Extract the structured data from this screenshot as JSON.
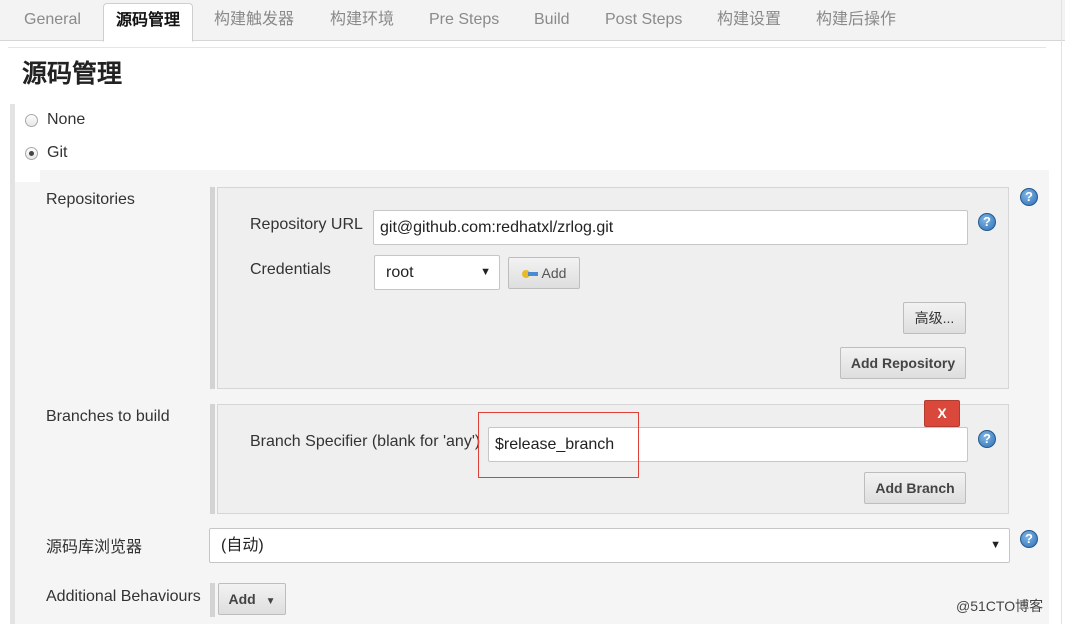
{
  "tabs": [
    {
      "label": "General",
      "active": false
    },
    {
      "label": "源码管理",
      "active": true
    },
    {
      "label": "构建触发器",
      "active": false
    },
    {
      "label": "构建环境",
      "active": false
    },
    {
      "label": "Pre Steps",
      "active": false
    },
    {
      "label": "Build",
      "active": false
    },
    {
      "label": "Post Steps",
      "active": false
    },
    {
      "label": "构建设置",
      "active": false
    },
    {
      "label": "构建后操作",
      "active": false
    }
  ],
  "section": {
    "title": "源码管理"
  },
  "scm_options": [
    {
      "label": "None",
      "selected": false
    },
    {
      "label": "Git",
      "selected": true
    }
  ],
  "repositories": {
    "label": "Repositories",
    "url_label": "Repository URL",
    "url_value": "git@github.com:redhatxl/zrlog.git",
    "credentials_label": "Credentials",
    "credentials_value": "root",
    "add_credentials_label": "Add",
    "advanced_label": "高级...",
    "add_repository_label": "Add Repository"
  },
  "branches": {
    "label": "Branches to build",
    "delete_label": "X",
    "specifier_label": "Branch Specifier (blank for 'any')",
    "specifier_value": "$release_branch",
    "add_branch_label": "Add Branch"
  },
  "browser": {
    "label": "源码库浏览器",
    "value": "(自动)"
  },
  "behaviours": {
    "label": "Additional Behaviours",
    "add_label": "Add"
  },
  "help_symbol": "?",
  "watermark": "@51CTO博客",
  "colors": {
    "delete_button": "#d9483b",
    "highlight_box": "#e0403a",
    "help_icon": "#2f6fb3"
  }
}
